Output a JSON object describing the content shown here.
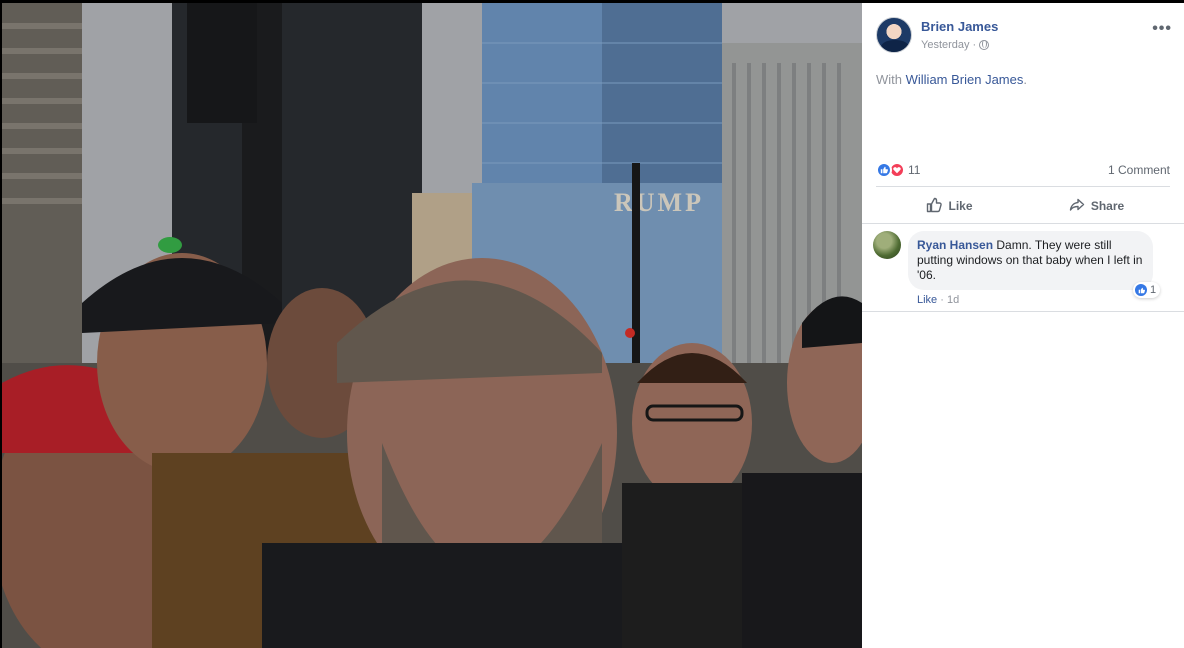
{
  "post": {
    "author": "Brien James",
    "time": "Yesterday",
    "time_separator": "·",
    "privacy_icon": "globe-icon",
    "with_prefix": "With",
    "tagged_user": "William Brien James",
    "tagged_suffix": ".",
    "more_icon": "more-icon"
  },
  "photo": {
    "sign_text": "RUMP"
  },
  "reactions": {
    "types": [
      "like",
      "love"
    ],
    "count": "11",
    "comment_count": "1 Comment"
  },
  "actions": {
    "like": "Like",
    "share": "Share"
  },
  "comments": [
    {
      "author": "Ryan Hansen",
      "text": "Damn. They were still putting windows on that baby when I left in '06.",
      "reaction_count": "1",
      "like_label": "Like",
      "separator": "·",
      "time": "1d"
    }
  ],
  "colors": {
    "link": "#385898",
    "like_blue": "#3578e5",
    "love_red": "#f33e58",
    "muted": "#90949c"
  }
}
